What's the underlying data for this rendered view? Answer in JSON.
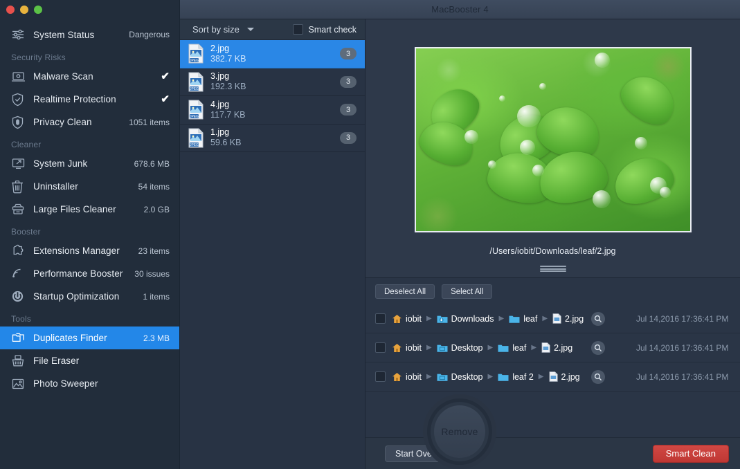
{
  "window": {
    "title": "MacBooster 4",
    "traffic_lights": [
      "close",
      "minimize",
      "zoom"
    ]
  },
  "sidebar": {
    "status_row": {
      "icon": "sliders-icon",
      "label": "System Status",
      "value": "Dangerous"
    },
    "groups": [
      {
        "title": "Security Risks",
        "items": [
          {
            "icon": "malware-laptop-icon",
            "label": "Malware Scan",
            "value": "✔",
            "value_kind": "check"
          },
          {
            "icon": "shield-check-icon",
            "label": "Realtime Protection",
            "value": "✔",
            "value_kind": "check"
          },
          {
            "icon": "shield-fingerprint-icon",
            "label": "Privacy Clean",
            "value": "1051 items",
            "value_kind": "text"
          }
        ]
      },
      {
        "title": "Cleaner",
        "items": [
          {
            "icon": "monitor-arrow-icon",
            "label": "System Junk",
            "value": "678.6 MB",
            "value_kind": "text"
          },
          {
            "icon": "trash-icon",
            "label": "Uninstaller",
            "value": "54 items",
            "value_kind": "text"
          },
          {
            "icon": "large-files-icon",
            "label": "Large Files Cleaner",
            "value": "2.0 GB",
            "value_kind": "text"
          }
        ]
      },
      {
        "title": "Booster",
        "items": [
          {
            "icon": "puzzle-icon",
            "label": "Extensions Manager",
            "value": "23 items",
            "value_kind": "text"
          },
          {
            "icon": "speed-waves-icon",
            "label": "Performance Booster",
            "value": "30 issues",
            "value_kind": "text"
          },
          {
            "icon": "power-icon",
            "label": "Startup Optimization",
            "value": "1 items",
            "value_kind": "text"
          }
        ]
      },
      {
        "title": "Tools",
        "items": [
          {
            "icon": "duplicate-folders-icon",
            "label": "Duplicates Finder",
            "value": "2.3 MB",
            "value_kind": "text",
            "selected": true
          },
          {
            "icon": "file-eraser-icon",
            "label": "File Eraser",
            "value": "",
            "value_kind": "text"
          },
          {
            "icon": "photo-icon",
            "label": "Photo Sweeper",
            "value": "",
            "value_kind": "text"
          }
        ]
      }
    ]
  },
  "list_toolbar": {
    "sort_label": "Sort by size",
    "sort_icon": "chevron-down-icon",
    "smart_check_label": "Smart check",
    "smart_check_checked": false
  },
  "file_list": [
    {
      "icon": "jpeg-file-icon",
      "name": "2.jpg",
      "size": "382.7 KB",
      "count": "3",
      "selected": true
    },
    {
      "icon": "jpeg-file-icon",
      "name": "3.jpg",
      "size": "192.3 KB",
      "count": "3",
      "selected": false
    },
    {
      "icon": "jpeg-file-icon",
      "name": "4.jpg",
      "size": "117.7 KB",
      "count": "3",
      "selected": false
    },
    {
      "icon": "jpeg-file-icon",
      "name": "1.jpg",
      "size": "59.6 KB",
      "count": "3",
      "selected": false
    }
  ],
  "preview": {
    "image_alt": "clover leaves with water droplets",
    "path": "/Users/iobit/Downloads/leaf/2.jpg",
    "drag_handle": "resize-handle"
  },
  "selection_buttons": {
    "deselect_all": "Deselect All",
    "select_all": "Select All"
  },
  "path_rows": [
    {
      "checked": false,
      "crumbs": [
        {
          "icon": "home-icon",
          "text": "iobit"
        },
        {
          "icon": "downloads-folder-icon",
          "text": "Downloads"
        },
        {
          "icon": "folder-icon",
          "text": "leaf"
        },
        {
          "icon": "file-icon",
          "text": "2.jpg"
        }
      ],
      "reveal_icon": "magnifier-icon",
      "date": "Jul 14,2016 17:36:41 PM"
    },
    {
      "checked": false,
      "crumbs": [
        {
          "icon": "home-icon",
          "text": "iobit"
        },
        {
          "icon": "desktop-folder-icon",
          "text": "Desktop"
        },
        {
          "icon": "folder-icon",
          "text": "leaf"
        },
        {
          "icon": "file-icon",
          "text": "2.jpg"
        }
      ],
      "reveal_icon": "magnifier-icon",
      "date": "Jul 14,2016 17:36:41 PM"
    },
    {
      "checked": false,
      "crumbs": [
        {
          "icon": "home-icon",
          "text": "iobit"
        },
        {
          "icon": "desktop-folder-icon",
          "text": "Desktop"
        },
        {
          "icon": "folder-icon",
          "text": "leaf 2"
        },
        {
          "icon": "file-icon",
          "text": "2.jpg"
        }
      ],
      "reveal_icon": "magnifier-icon",
      "date": "Jul 14,2016 17:36:41 PM"
    }
  ],
  "remove_button": {
    "label": "Remove"
  },
  "footer": {
    "start_over": "Start Over",
    "smart_clean": "Smart Clean"
  },
  "colors": {
    "accent_blue": "#2a87e6",
    "sidebar_bg": "#222d3b",
    "panel_bg": "#2e394a",
    "danger_red": "#c93c38"
  }
}
